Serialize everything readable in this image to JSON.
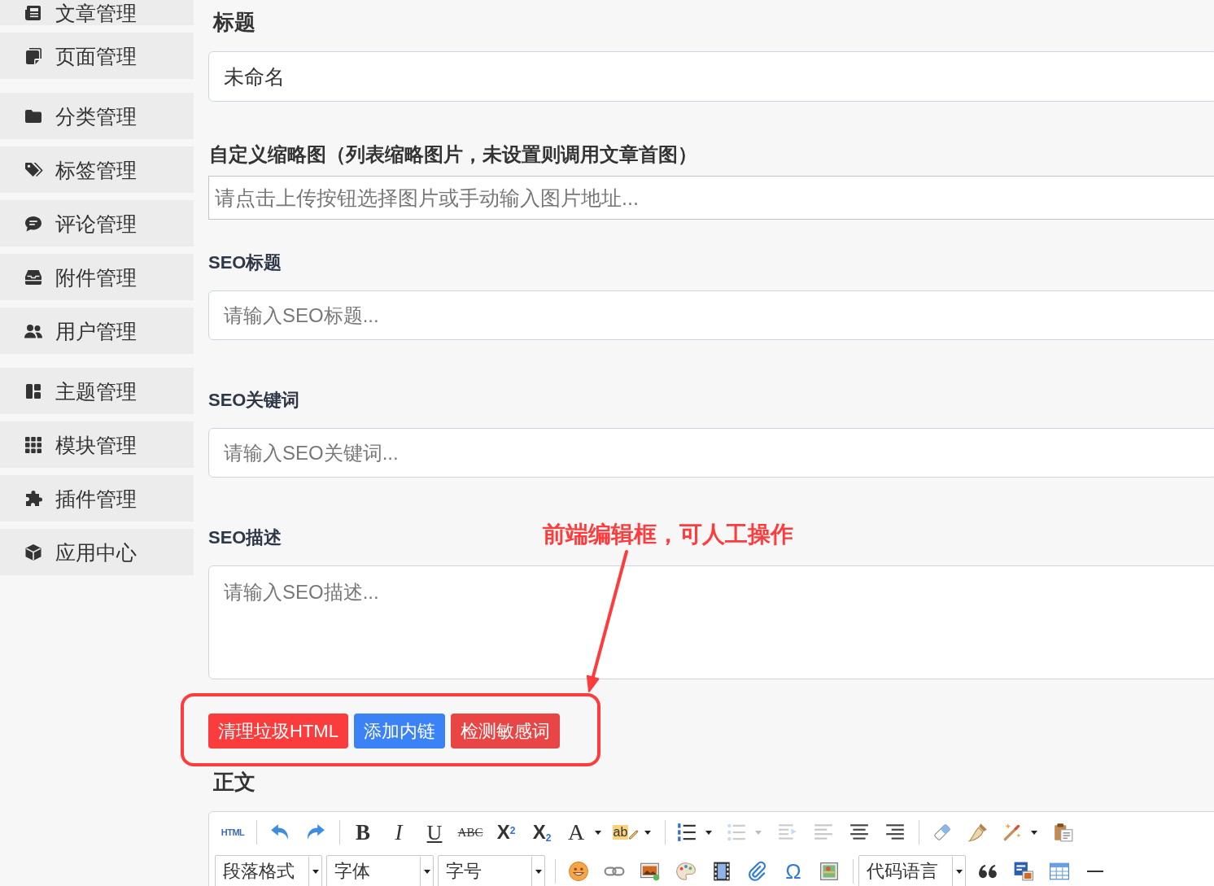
{
  "sidebar": {
    "groups": [
      {
        "items": [
          {
            "label": "文章管理"
          },
          {
            "label": "页面管理"
          }
        ]
      },
      {
        "items": [
          {
            "label": "分类管理"
          },
          {
            "label": "标签管理"
          },
          {
            "label": "评论管理"
          },
          {
            "label": "附件管理"
          },
          {
            "label": "用户管理"
          }
        ]
      },
      {
        "items": [
          {
            "label": "主题管理"
          },
          {
            "label": "模块管理"
          },
          {
            "label": "插件管理"
          },
          {
            "label": "应用中心"
          }
        ]
      }
    ]
  },
  "form": {
    "fields": [
      {
        "kind": "title",
        "label": "标题",
        "value": "未命名"
      },
      {
        "kind": "image-url",
        "label": "自定义缩略图（列表缩略图片，未设置则调用文章首图）",
        "placeholder": "请点击上传按钮选择图片或手动输入图片地址..."
      },
      {
        "kind": "text",
        "label": "SEO标题",
        "placeholder": "请输入SEO标题..."
      },
      {
        "kind": "text",
        "label": "SEO关键词",
        "placeholder": "请输入SEO关键词..."
      },
      {
        "kind": "textarea",
        "label": "SEO描述",
        "placeholder": "请输入SEO描述..."
      }
    ],
    "actions": [
      {
        "label": "清理垃圾HTML",
        "color": "#fb3c3c"
      },
      {
        "label": "添加内链",
        "color": "#3b82f6"
      },
      {
        "label": "检测敏感词",
        "color": "#e94545"
      }
    ]
  },
  "annotation": {
    "text": "前端编辑框，可人工操作"
  },
  "editor": {
    "label": "正文",
    "toolbar_rows": [
      {
        "groups": [
          {
            "tools": [
              {
                "kind": "html",
                "label": "HTML",
                "disabled": false
              }
            ]
          },
          {
            "tools": [
              {
                "kind": "undo",
                "disabled": false
              },
              {
                "kind": "redo",
                "disabled": false
              }
            ]
          },
          {
            "tools": [
              {
                "kind": "bold",
                "label": "B",
                "disabled": false
              },
              {
                "kind": "italic",
                "label": "I",
                "disabled": false
              },
              {
                "kind": "underline",
                "label": "U",
                "disabled": false
              },
              {
                "kind": "strikethrough",
                "label": "ABC",
                "disabled": false
              },
              {
                "kind": "superscript",
                "label": "X$^{2}$",
                "disabled": false
              },
              {
                "kind": "subscript",
                "label": "X$_{2}$",
                "disabled": false
              },
              {
                "kind": "font-color",
                "label": "A",
                "disabled": false
              },
              {
                "kind": "highlight",
                "label": "ab",
                "disabled": false
              }
            ]
          },
          {
            "tools": [
              {
                "kind": "ordered-list",
                "disabled": false
              },
              {
                "kind": "unordered-list",
                "disabled": true
              },
              {
                "kind": "indent",
                "disabled": true
              },
              {
                "kind": "align-left",
                "disabled": true
              },
              {
                "kind": "align-center",
                "disabled": false
              },
              {
                "kind": "align-right",
                "disabled": false
              }
            ]
          },
          {
            "tools": [
              {
                "kind": "eraser",
                "disabled": false
              },
              {
                "kind": "format-brush",
                "disabled": false
              },
              {
                "kind": "auto-format",
                "disabled": false
              },
              {
                "kind": "paste-text",
                "disabled": false
              }
            ]
          }
        ]
      },
      {
        "groups": [
          {
            "tools": [
              {
                "kind": "select",
                "label": "段落格式",
                "disabled": false
              },
              {
                "kind": "select",
                "label": "字体",
                "disabled": false
              },
              {
                "kind": "select",
                "label": "字号",
                "disabled": false
              }
            ]
          },
          {
            "tools": [
              {
                "kind": "emotion",
                "disabled": false
              },
              {
                "kind": "link",
                "disabled": false
              },
              {
                "kind": "image",
                "disabled": false
              },
              {
                "kind": "scrawl",
                "disabled": false
              },
              {
                "kind": "video",
                "disabled": false
              },
              {
                "kind": "attachment",
                "disabled": false
              },
              {
                "kind": "special-chars",
                "label": "Ω",
                "disabled": false
              },
              {
                "kind": "map",
                "disabled": false
              }
            ]
          },
          {
            "tools": [
              {
                "kind": "select",
                "label": "代码语言",
                "disabled": false
              },
              {
                "kind": "blockquote",
                "disabled": false
              },
              {
                "kind": "word-import",
                "disabled": false
              },
              {
                "kind": "table",
                "disabled": false
              },
              {
                "kind": "horizontal-rule",
                "disabled": false
              }
            ]
          }
        ]
      }
    ]
  }
}
